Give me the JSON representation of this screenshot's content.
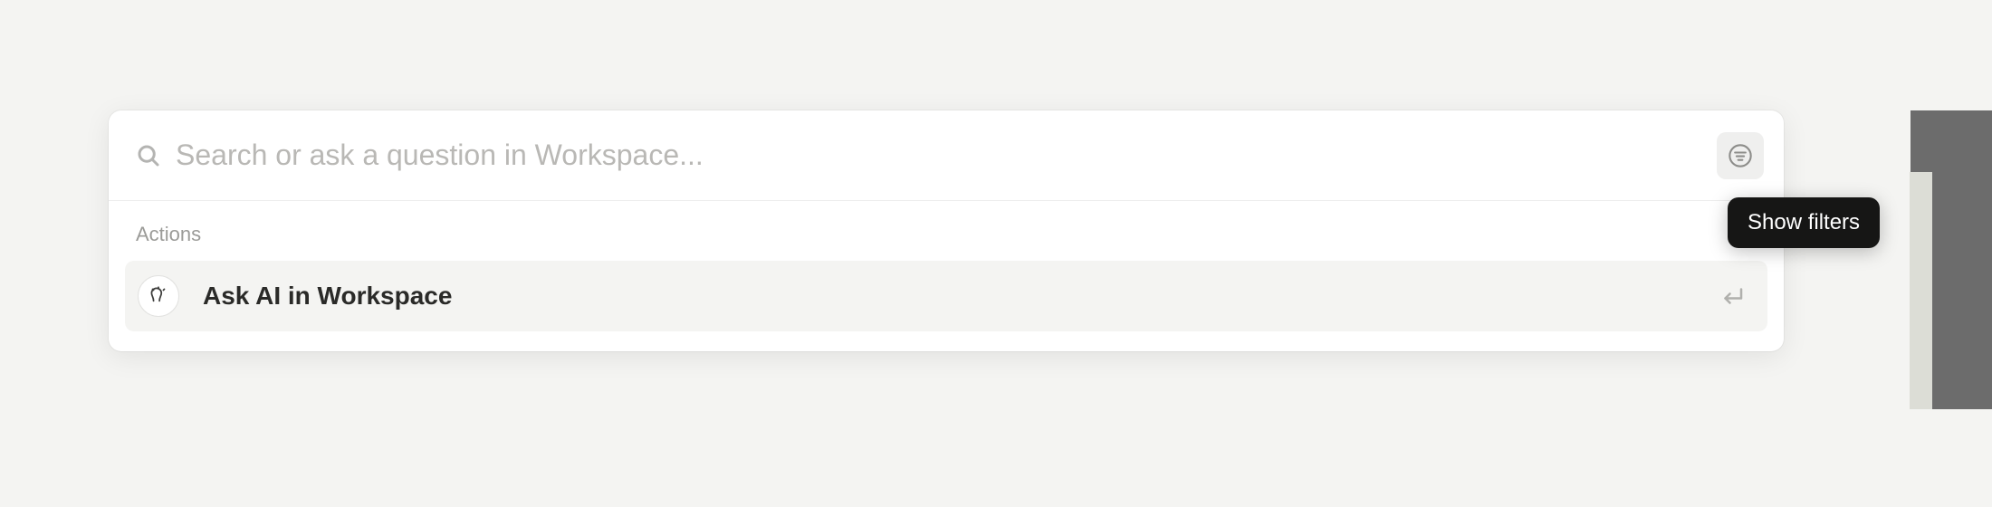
{
  "search": {
    "placeholder": "Search or ask a question in Workspace..."
  },
  "sections": {
    "actions": {
      "label": "Actions"
    }
  },
  "actions": [
    {
      "label": "Ask AI in Workspace"
    }
  ],
  "tooltip": {
    "show_filters": "Show filters"
  }
}
